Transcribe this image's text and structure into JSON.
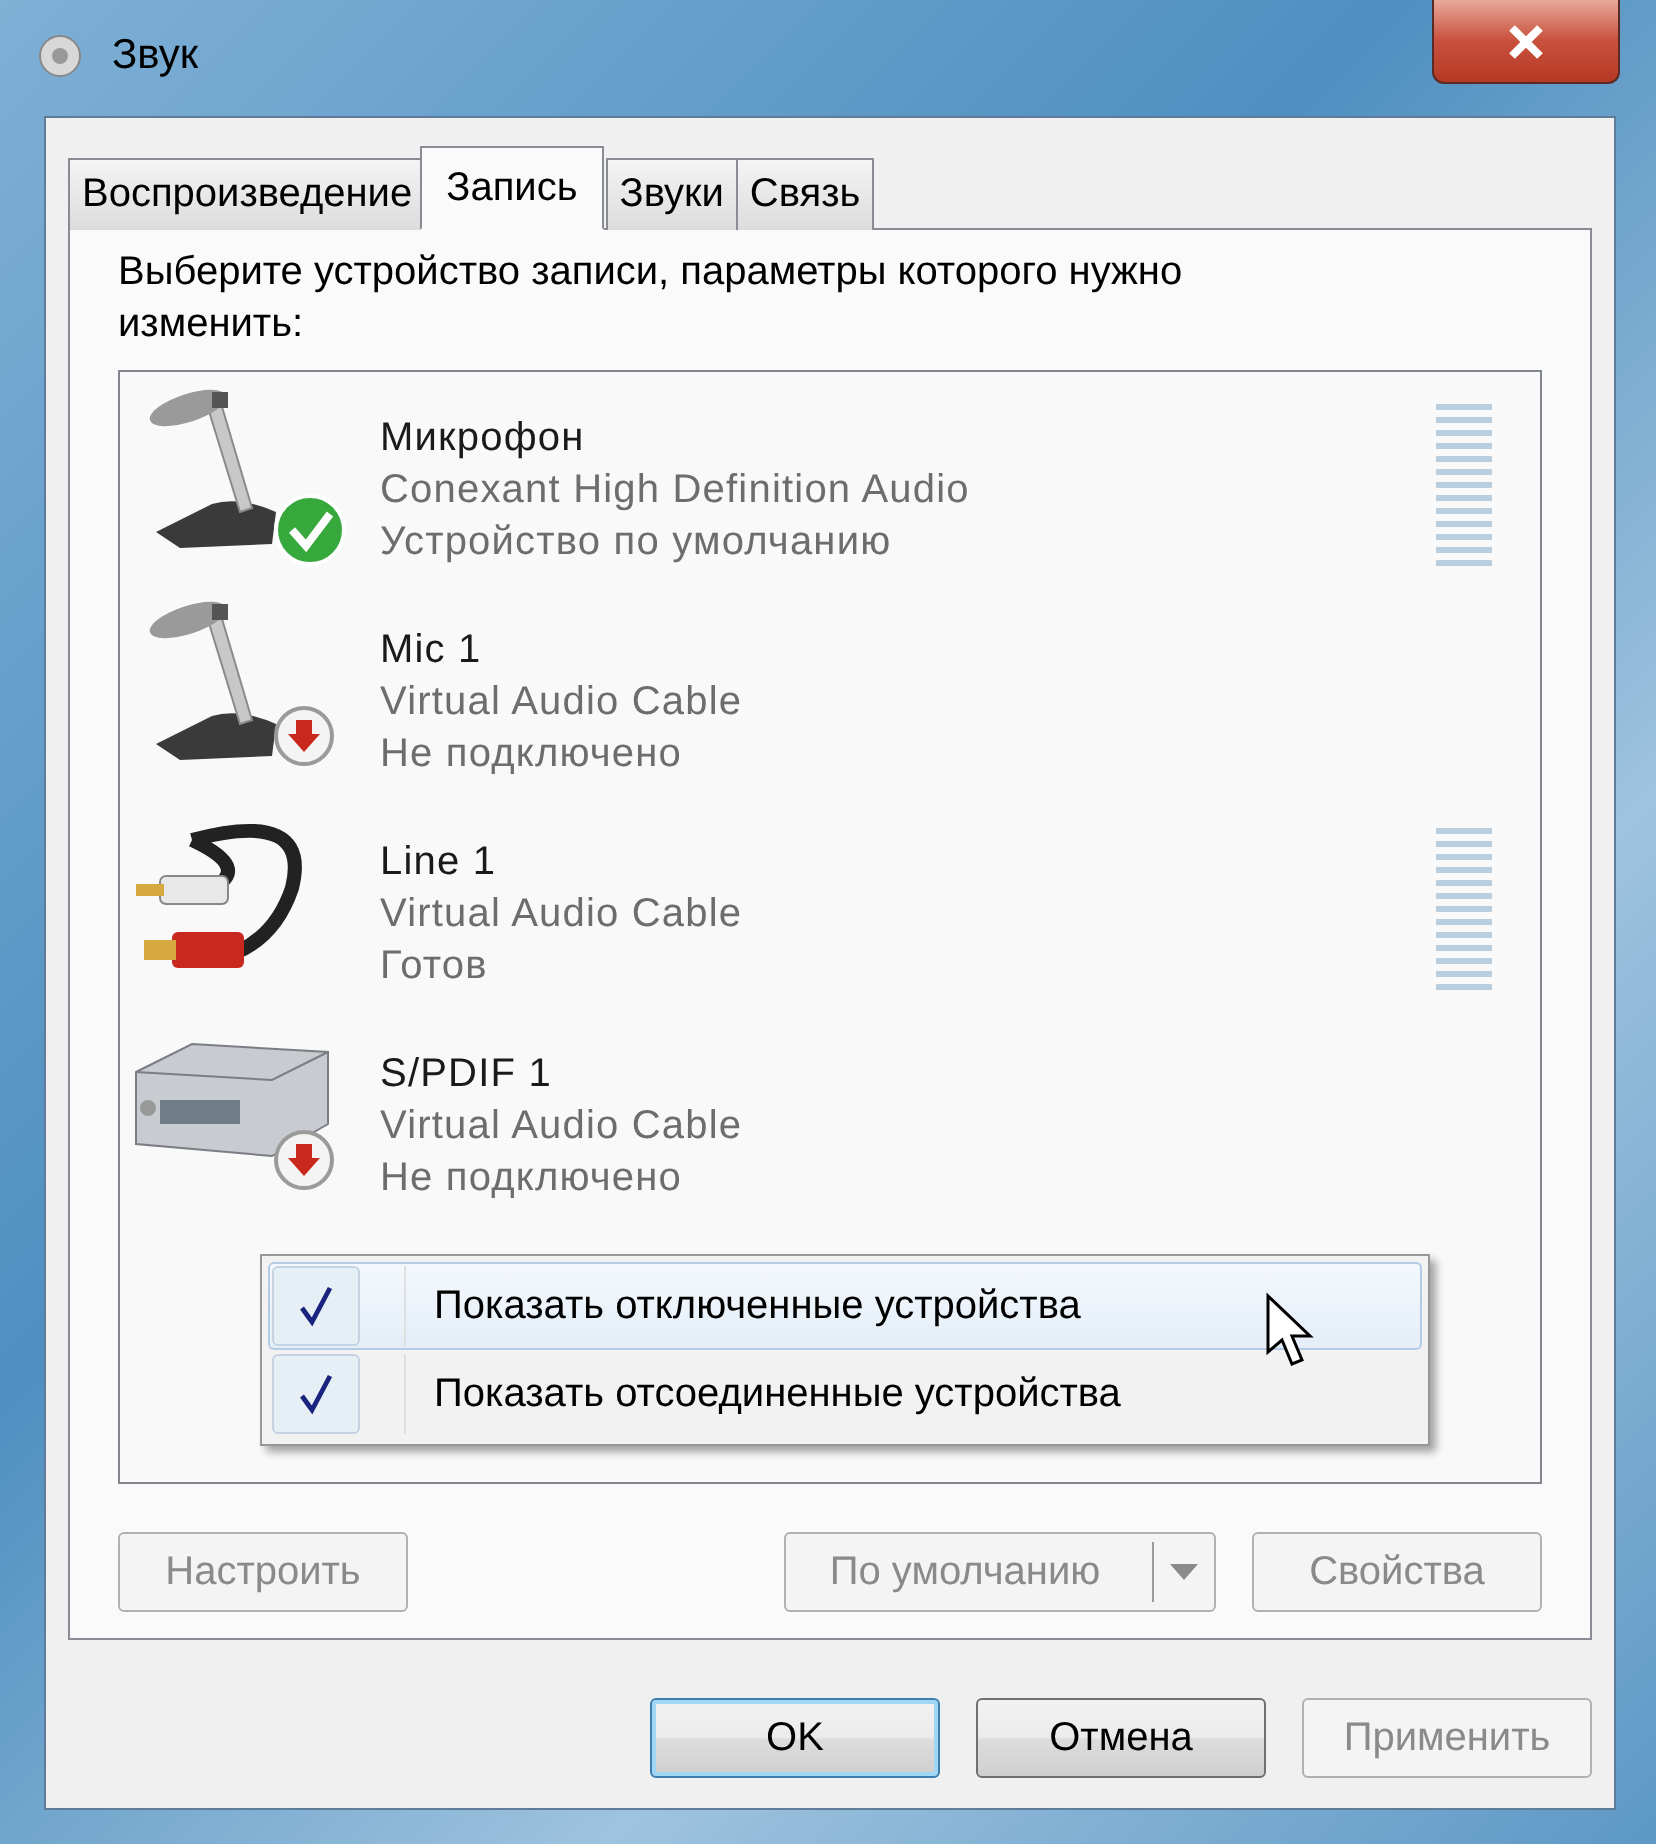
{
  "window": {
    "title": "Звук"
  },
  "tabs": [
    {
      "label": "Воспроизведение",
      "selected": false
    },
    {
      "label": "Запись",
      "selected": true
    },
    {
      "label": "Звуки",
      "selected": false
    },
    {
      "label": "Связь",
      "selected": false
    }
  ],
  "instruction": "Выберите устройство записи, параметры которого нужно изменить:",
  "devices": [
    {
      "kind": "microphone",
      "name": "Микрофон",
      "driver": "Conexant High Definition Audio",
      "status": "Устройство по умолчанию",
      "is_default": true,
      "unplugged": false,
      "meter": true
    },
    {
      "kind": "microphone",
      "name": "Mic 1",
      "driver": "Virtual Audio Cable",
      "status": "Не подключено",
      "is_default": false,
      "unplugged": true,
      "meter": false
    },
    {
      "kind": "cable",
      "name": "Line 1",
      "driver": "Virtual Audio Cable",
      "status": "Готов",
      "is_default": false,
      "unplugged": false,
      "meter": true
    },
    {
      "kind": "receiver",
      "name": "S/PDIF 1",
      "driver": "Virtual Audio Cable",
      "status": "Не подключено",
      "is_default": false,
      "unplugged": true,
      "meter": false
    }
  ],
  "context_menu": [
    {
      "label": "Показать отключенные устройства",
      "checked": true,
      "selected": true
    },
    {
      "label": "Показать отсоединенные устройства",
      "checked": true,
      "selected": false
    }
  ],
  "device_buttons": [
    {
      "kind": "push",
      "label": "Настроить",
      "disabled": true
    },
    {
      "kind": "split",
      "label": "По умолчанию",
      "disabled": true
    },
    {
      "kind": "push",
      "label": "Свойства",
      "disabled": true
    }
  ],
  "dialog_buttons": [
    {
      "label": "OK",
      "default": true,
      "disabled": false
    },
    {
      "label": "Отмена",
      "default": false,
      "disabled": false
    },
    {
      "label": "Применить",
      "default": false,
      "disabled": true
    }
  ]
}
